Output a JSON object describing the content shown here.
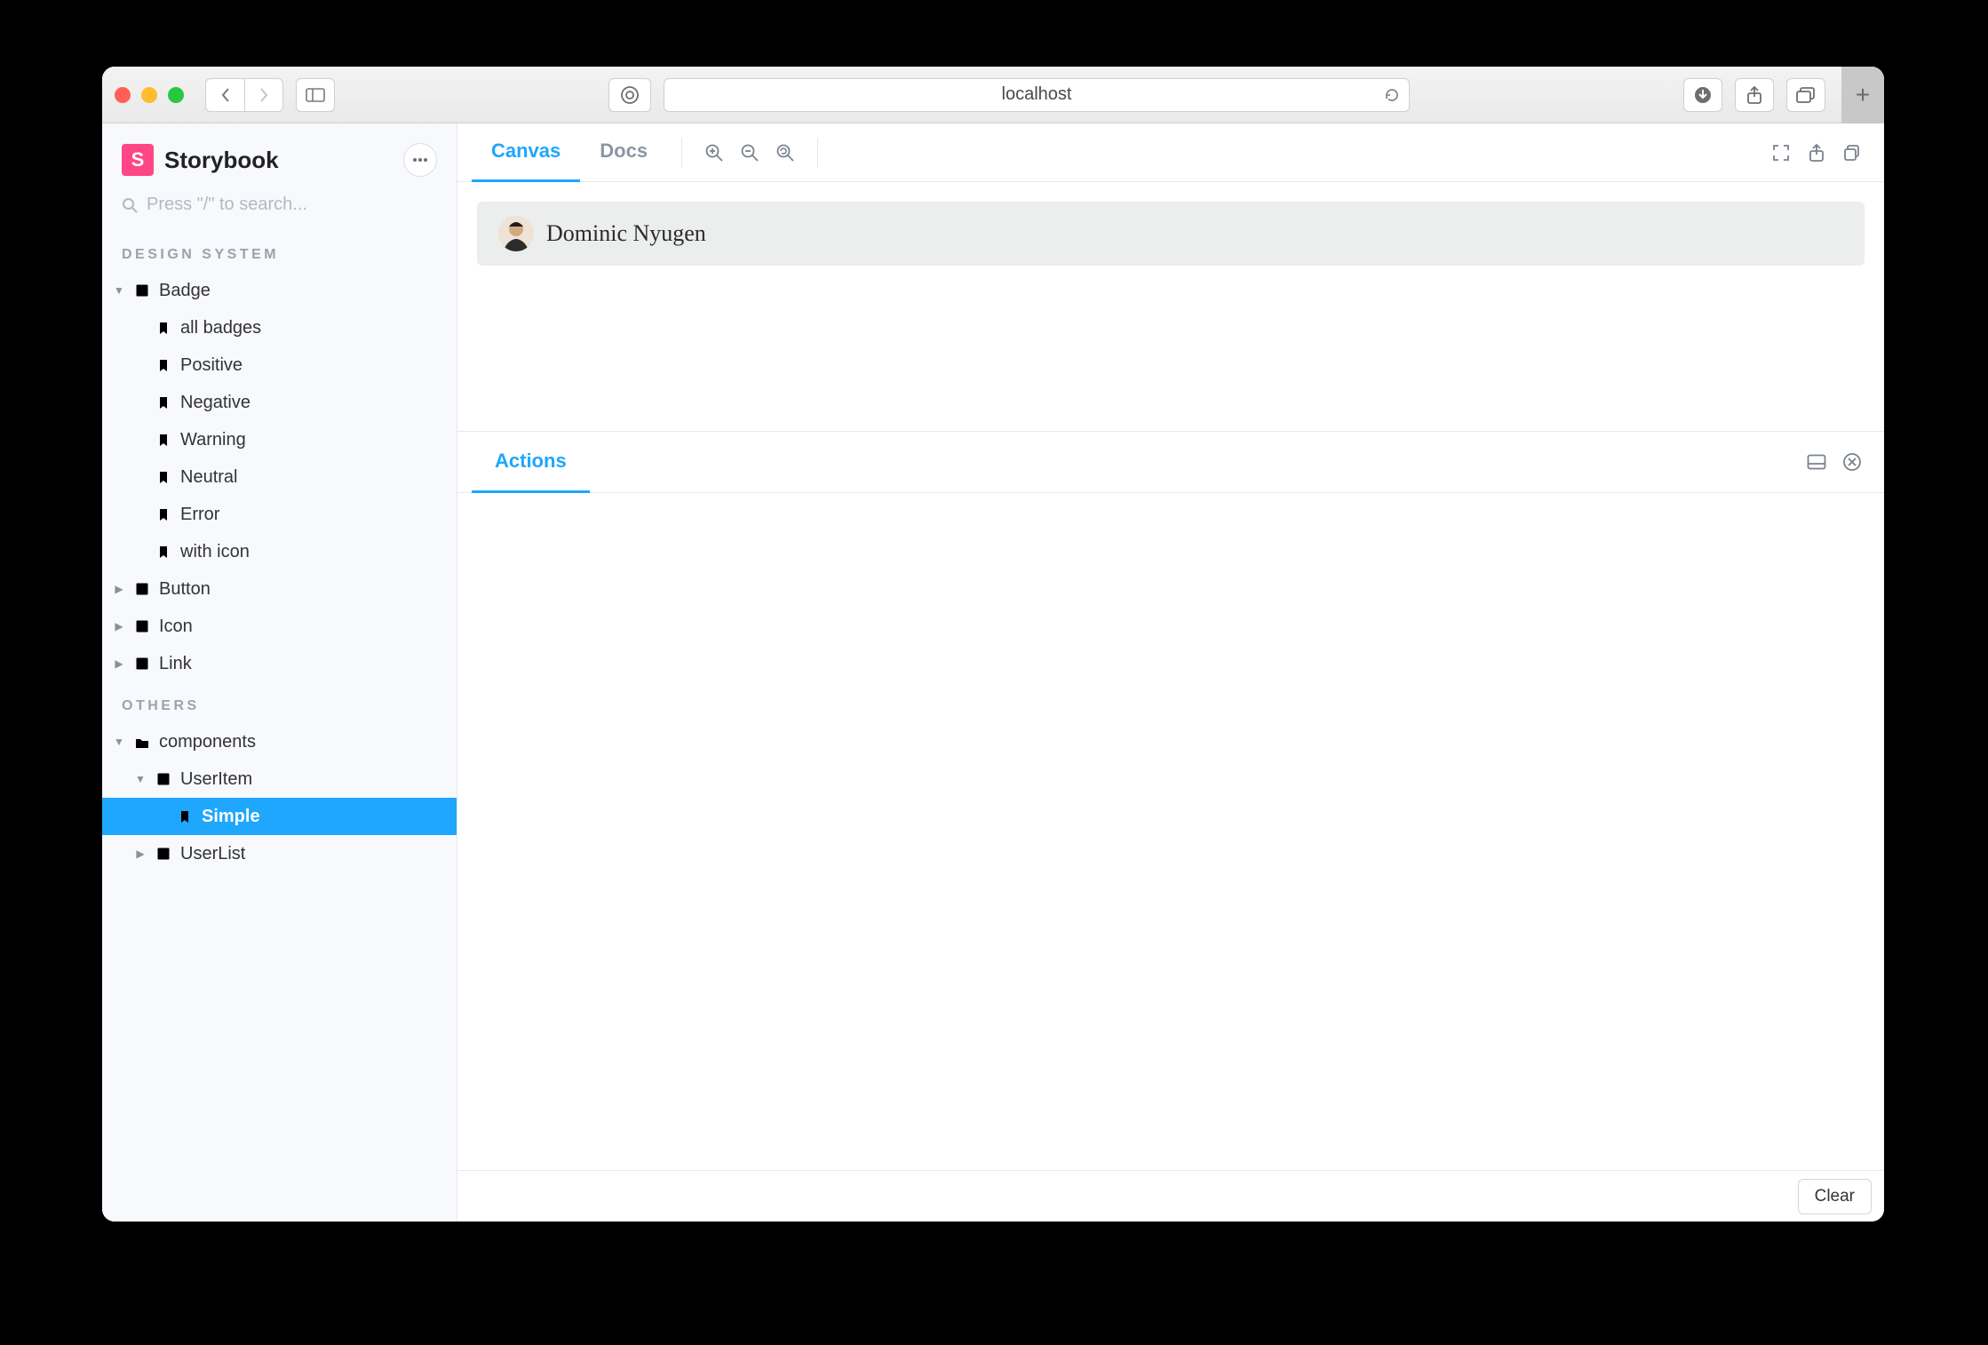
{
  "browser": {
    "url": "localhost"
  },
  "brand": {
    "name": "Storybook",
    "mark": "S"
  },
  "sidebar": {
    "search_placeholder": "Press \"/\" to search...",
    "sections": [
      {
        "title": "DESIGN SYSTEM",
        "items": [
          {
            "kind": "component",
            "label": "Badge",
            "expanded": true
          },
          {
            "kind": "story",
            "label": "all badges"
          },
          {
            "kind": "story",
            "label": "Positive"
          },
          {
            "kind": "story",
            "label": "Negative"
          },
          {
            "kind": "story",
            "label": "Warning"
          },
          {
            "kind": "story",
            "label": "Neutral"
          },
          {
            "kind": "story",
            "label": "Error"
          },
          {
            "kind": "story",
            "label": "with icon"
          },
          {
            "kind": "component",
            "label": "Button",
            "expanded": false
          },
          {
            "kind": "component",
            "label": "Icon",
            "expanded": false
          },
          {
            "kind": "component",
            "label": "Link",
            "expanded": false
          }
        ]
      },
      {
        "title": "OTHERS",
        "items": [
          {
            "kind": "folder",
            "label": "components",
            "expanded": true
          },
          {
            "kind": "component",
            "label": "UserItem",
            "expanded": true
          },
          {
            "kind": "story",
            "label": "Simple",
            "selected": true
          },
          {
            "kind": "component",
            "label": "UserList",
            "expanded": false
          }
        ]
      }
    ]
  },
  "tabs": {
    "canvas": "Canvas",
    "docs": "Docs"
  },
  "preview": {
    "user_name": "Dominic Nyugen"
  },
  "addons": {
    "actions_tab": "Actions",
    "clear_label": "Clear"
  }
}
